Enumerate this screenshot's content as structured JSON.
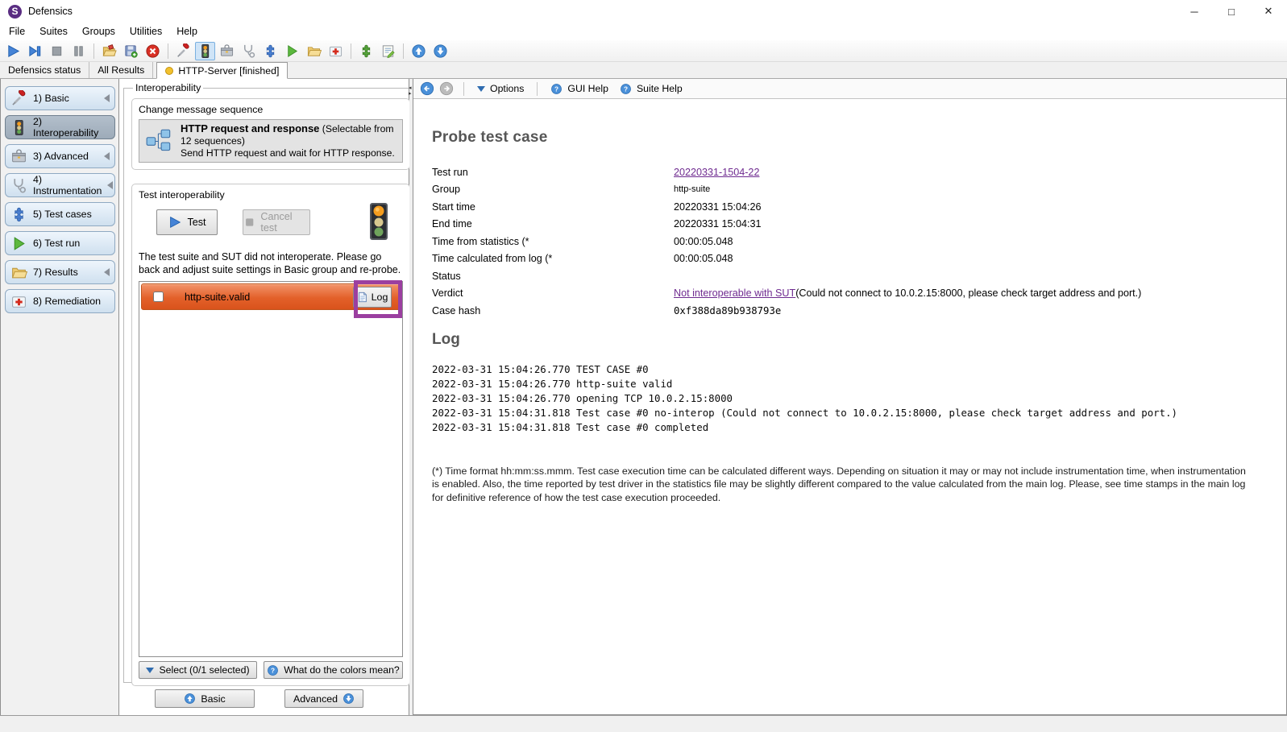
{
  "window": {
    "title": "Defensics",
    "logo_letter": "S",
    "controls": {
      "minimize": "─",
      "maximize": "□",
      "close": "✕"
    }
  },
  "menu": {
    "items": [
      "File",
      "Suites",
      "Groups",
      "Utilities",
      "Help"
    ]
  },
  "toolbar": {
    "icons": [
      "run-icon",
      "step-icon",
      "stop-icon",
      "pause-icon",
      "load-suite-icon",
      "save-icon",
      "abort-icon",
      "basic-icon",
      "interoperability-icon",
      "advanced-icon",
      "instrumentation-icon",
      "test-cases-icon",
      "test-run-icon",
      "results-icon",
      "remediation-icon",
      "reload-icon",
      "notes-icon",
      "up-icon",
      "down-icon"
    ],
    "selected_icon": "interoperability-icon"
  },
  "tabs": [
    {
      "label": "Defensics status"
    },
    {
      "label": "All Results"
    },
    {
      "label": "HTTP-Server [finished]",
      "active": true
    }
  ],
  "sidebar": {
    "items": [
      {
        "label": "1) Basic",
        "icon": "screwdriver-icon",
        "has_arrow": true
      },
      {
        "label": "2) Interoperability",
        "icon": "traffic-light-icon",
        "selected": true
      },
      {
        "label": "3) Advanced",
        "icon": "toolbox-icon",
        "has_arrow": true
      },
      {
        "label": "4) Instrumentation",
        "icon": "stethoscope-icon",
        "has_arrow": true
      },
      {
        "label": "5) Test cases",
        "icon": "puzzle-icon"
      },
      {
        "label": "6) Test run",
        "icon": "play-icon"
      },
      {
        "label": "7) Results",
        "icon": "folder-icon",
        "has_arrow": true
      },
      {
        "label": "8) Remediation",
        "icon": "first-aid-icon"
      }
    ]
  },
  "middle": {
    "legend": "Interoperability",
    "sequence": {
      "group_title": "Change message sequence",
      "title": "HTTP request and response",
      "note": " (Selectable from 12 sequences)",
      "desc": "Send HTTP request and wait for HTTP response."
    },
    "test": {
      "group_title": "Test interoperability",
      "test_label": "Test",
      "cancel_label": "Cancel test",
      "message": "The test suite and SUT did not interoperate. Please go back and adjust suite settings in Basic group and re-probe.",
      "row": {
        "name": "http-suite.valid",
        "log_label": "Log",
        "checked": false
      },
      "select_label": "Select (0/1 selected)",
      "colors_label": "What do the colors mean?"
    },
    "nav": {
      "basic_label": "Basic",
      "advanced_label": "Advanced"
    }
  },
  "right": {
    "nav": {
      "options_label": "Options",
      "gui_help_label": "GUI Help",
      "suite_help_label": "Suite Help"
    },
    "probe": {
      "title": "Probe test case",
      "fields": [
        {
          "label": "Test run",
          "value": "20220331-1504-22"
        },
        {
          "label": "Group",
          "value": "http-suite"
        },
        {
          "label": "Start time",
          "value": "20220331 15:04:26"
        },
        {
          "label": "End time",
          "value": "20220331 15:04:31"
        },
        {
          "label": "Time from statistics (*",
          "value": "00:00:05.048"
        },
        {
          "label": "Time calculated from log (*",
          "value": "00:00:05.048"
        },
        {
          "label": "Status",
          "value": ""
        },
        {
          "label": "Verdict",
          "link_text": "Not interoperable with SUT",
          "value_rest": " (Could not connect to 10.0.2.15:8000, please check target address and port.)"
        },
        {
          "label": "Case hash",
          "value": "0xf388da89b938793e"
        }
      ]
    },
    "log": {
      "title": "Log",
      "lines": [
        "2022-03-31 15:04:26.770 TEST CASE #0",
        "2022-03-31 15:04:26.770 http-suite valid",
        "2022-03-31 15:04:26.770 opening TCP 10.0.2.15:8000",
        "2022-03-31 15:04:31.818 Test case #0 no-interop (Could not connect to 10.0.2.15:8000, please check target address and port.)",
        "2022-03-31 15:04:31.818 Test case #0 completed"
      ]
    },
    "footnote": "(*) Time format hh:mm:ss.mmm. Test case execution time can be calculated different ways. Depending on situation it may or may not include instrumentation time, when instrumentation is enabled. Also, the time reported by test driver in the statistics file may be slightly different compared to the value calculated from the main log. Please, see time stamps in the main log for definitive reference of how the test case execution proceeded."
  },
  "colors": {
    "annotation": "#9b3fa0",
    "row_orange_top": "#f2946a",
    "row_orange_bottom": "#d9531c",
    "link_purple": "#6f2b90",
    "accent_blue": "#4a90d9",
    "logo_purple": "#5a2d82",
    "tab_dot_yellow": "#f2c12e"
  }
}
